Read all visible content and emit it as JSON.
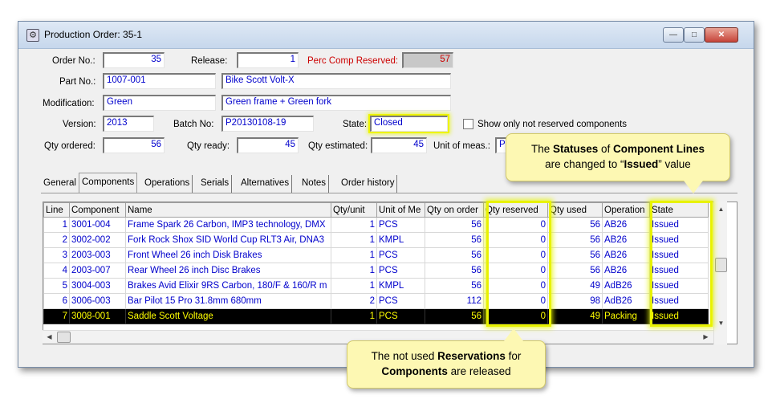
{
  "window": {
    "title": "Production Order: 35-1",
    "buttons": {
      "minimize": "—",
      "maximize": "□",
      "close": "✕"
    }
  },
  "form": {
    "order_no_label": "Order No.:",
    "order_no": "35",
    "release_label": "Release:",
    "release": "1",
    "perc_label": "Perc Comp Reserved:",
    "perc": "57",
    "part_no_label": "Part No.:",
    "part_no": "1007-001",
    "part_desc": "Bike Scott Volt-X",
    "modification_label": "Modification:",
    "modification": "Green",
    "modification_desc": "Green frame + Green fork",
    "version_label": "Version:",
    "version": "2013",
    "batch_label": "Batch No:",
    "batch": "P20130108-19",
    "state_label": "State:",
    "state": "Closed",
    "show_only_label": "Show only not reserved components",
    "qty_ordered_label": "Qty ordered:",
    "qty_ordered": "56",
    "qty_ready_label": "Qty ready:",
    "qty_ready": "45",
    "qty_estimated_label": "Qty estimated:",
    "qty_estimated": "45",
    "unit_label": "Unit of meas.:",
    "unit": "P"
  },
  "tabs": [
    "General",
    "Components",
    "Operations",
    "Serials",
    "Alternatives",
    "Notes",
    "Order history"
  ],
  "table": {
    "headers": [
      "Line",
      "Component",
      "Name",
      "Qty/unit",
      "Unit of Me",
      "Qty on order",
      "Qty reserved",
      "Qty used",
      "Operation",
      "State"
    ],
    "rows": [
      [
        "1",
        "3001-004",
        "Frame Spark 26 Carbon, IMP3 technology, DMX",
        "1",
        "PCS",
        "56",
        "0",
        "56",
        "AB26",
        "Issued"
      ],
      [
        "2",
        "3002-002",
        "Fork Rock Shox SID World Cup RLT3 Air, DNA3",
        "1",
        "KMPL",
        "56",
        "0",
        "56",
        "AB26",
        "Issued"
      ],
      [
        "3",
        "2003-003",
        "Front Wheel 26 inch Disk Brakes",
        "1",
        "PCS",
        "56",
        "0",
        "56",
        "AB26",
        "Issued"
      ],
      [
        "4",
        "2003-007",
        "Rear Wheel 26 inch Disc Brakes",
        "1",
        "PCS",
        "56",
        "0",
        "56",
        "AB26",
        "Issued"
      ],
      [
        "5",
        "3004-003",
        "Brakes Avid Elixir 9RS Carbon, 180/F & 160/R m",
        "1",
        "KMPL",
        "56",
        "0",
        "49",
        "AdB26",
        "Issued"
      ],
      [
        "6",
        "3006-003",
        "Bar Pilot 15 Pro 31.8mm 680mm",
        "2",
        "PCS",
        "112",
        "0",
        "98",
        "AdB26",
        "Issued"
      ],
      [
        "7",
        "3008-001",
        "Saddle Scott Voltage",
        "1",
        "PCS",
        "56",
        "0",
        "49",
        "Packing",
        "Issued"
      ]
    ]
  },
  "callout_top": {
    "p1": "The ",
    "b1": "Statuses",
    "p2": " of ",
    "b2": "Component Lines",
    "p3": "are changed to “",
    "b3": "Issued",
    "p4": "” value"
  },
  "callout_bottom": {
    "p1": "The not used ",
    "b1": "Reservations",
    "p2": " for",
    "b2": "Components",
    "p3": " are released"
  },
  "scroll": {
    "up": "▲",
    "down": "▼",
    "left": "◀",
    "right": "▶"
  }
}
